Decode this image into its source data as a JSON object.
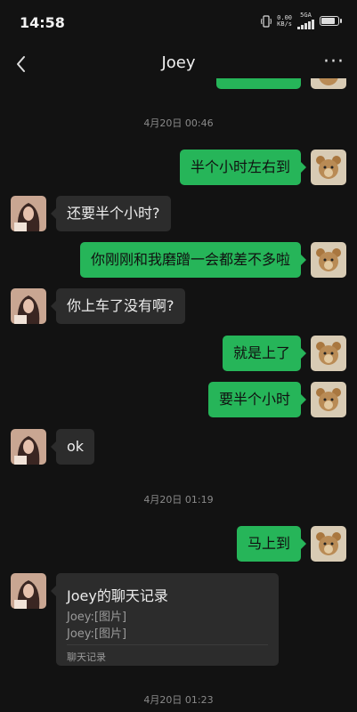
{
  "status_bar": {
    "time": "14:58",
    "network_speed_value": "0.00",
    "network_speed_unit": "KB/s",
    "network_type": "5GA",
    "battery_level": 0.9
  },
  "header": {
    "title": "Joey",
    "back_icon": "chevron-left-icon",
    "more_icon": "more-dots-icon"
  },
  "colors": {
    "background": "#121212",
    "outgoing_bubble": "#26b559",
    "incoming_bubble": "#2c2c2c",
    "timestamp_text": "#8a8a8a"
  },
  "messages": [
    {
      "type": "timestamp",
      "text": "4月20日 00:46"
    },
    {
      "type": "outgoing",
      "text": "半个小时左右到"
    },
    {
      "type": "incoming",
      "text": "还要半个小时?"
    },
    {
      "type": "outgoing",
      "text": "你刚刚和我磨蹭一会都差不多啦"
    },
    {
      "type": "incoming",
      "text": "你上车了没有啊?"
    },
    {
      "type": "outgoing",
      "text": "就是上了"
    },
    {
      "type": "outgoing",
      "text": "要半个小时"
    },
    {
      "type": "incoming",
      "text": "ok"
    },
    {
      "type": "timestamp",
      "text": "4月20日 01:19"
    },
    {
      "type": "outgoing",
      "text": "马上到"
    },
    {
      "type": "incoming_card",
      "title": "Joey的聊天记录",
      "lines": [
        "Joey:[图片]",
        "Joey:[图片]"
      ],
      "footer": "聊天记录"
    },
    {
      "type": "timestamp",
      "text": "4月20日 01:23"
    }
  ]
}
